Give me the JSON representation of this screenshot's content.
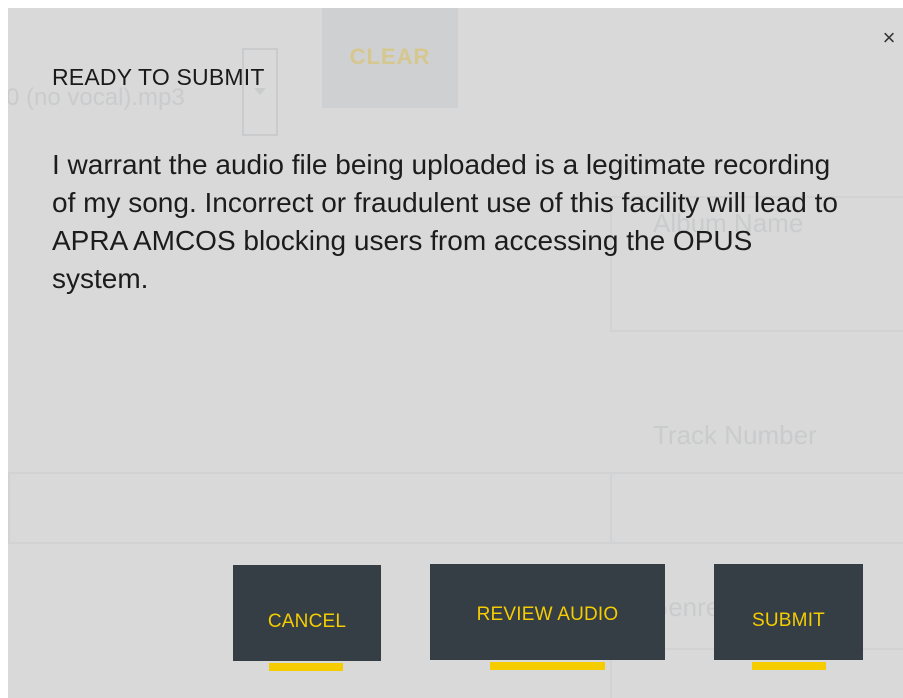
{
  "modal": {
    "title": "READY TO SUBMIT",
    "close_label": "×",
    "body": "I warrant the audio file being uploaded is a legitimate recording of my song. Incorrect or fraudulent use of this facility will lead to APRA AMCOS blocking users from accessing the OPUS system.",
    "buttons": {
      "cancel": "CANCEL",
      "review_audio": "REVIEW AUDIO",
      "submit": "SUBMIT"
    }
  },
  "background_form": {
    "file_name": "0 (no vocal).mp3",
    "clear_button": "CLEAR",
    "album_name_label": "Album Name",
    "track_number_label": "Track Number",
    "genre_label": "Genre"
  },
  "colors": {
    "button_bg": "#353d45",
    "accent": "#f4cc00",
    "dialog_bg": "#d9d9d9"
  }
}
